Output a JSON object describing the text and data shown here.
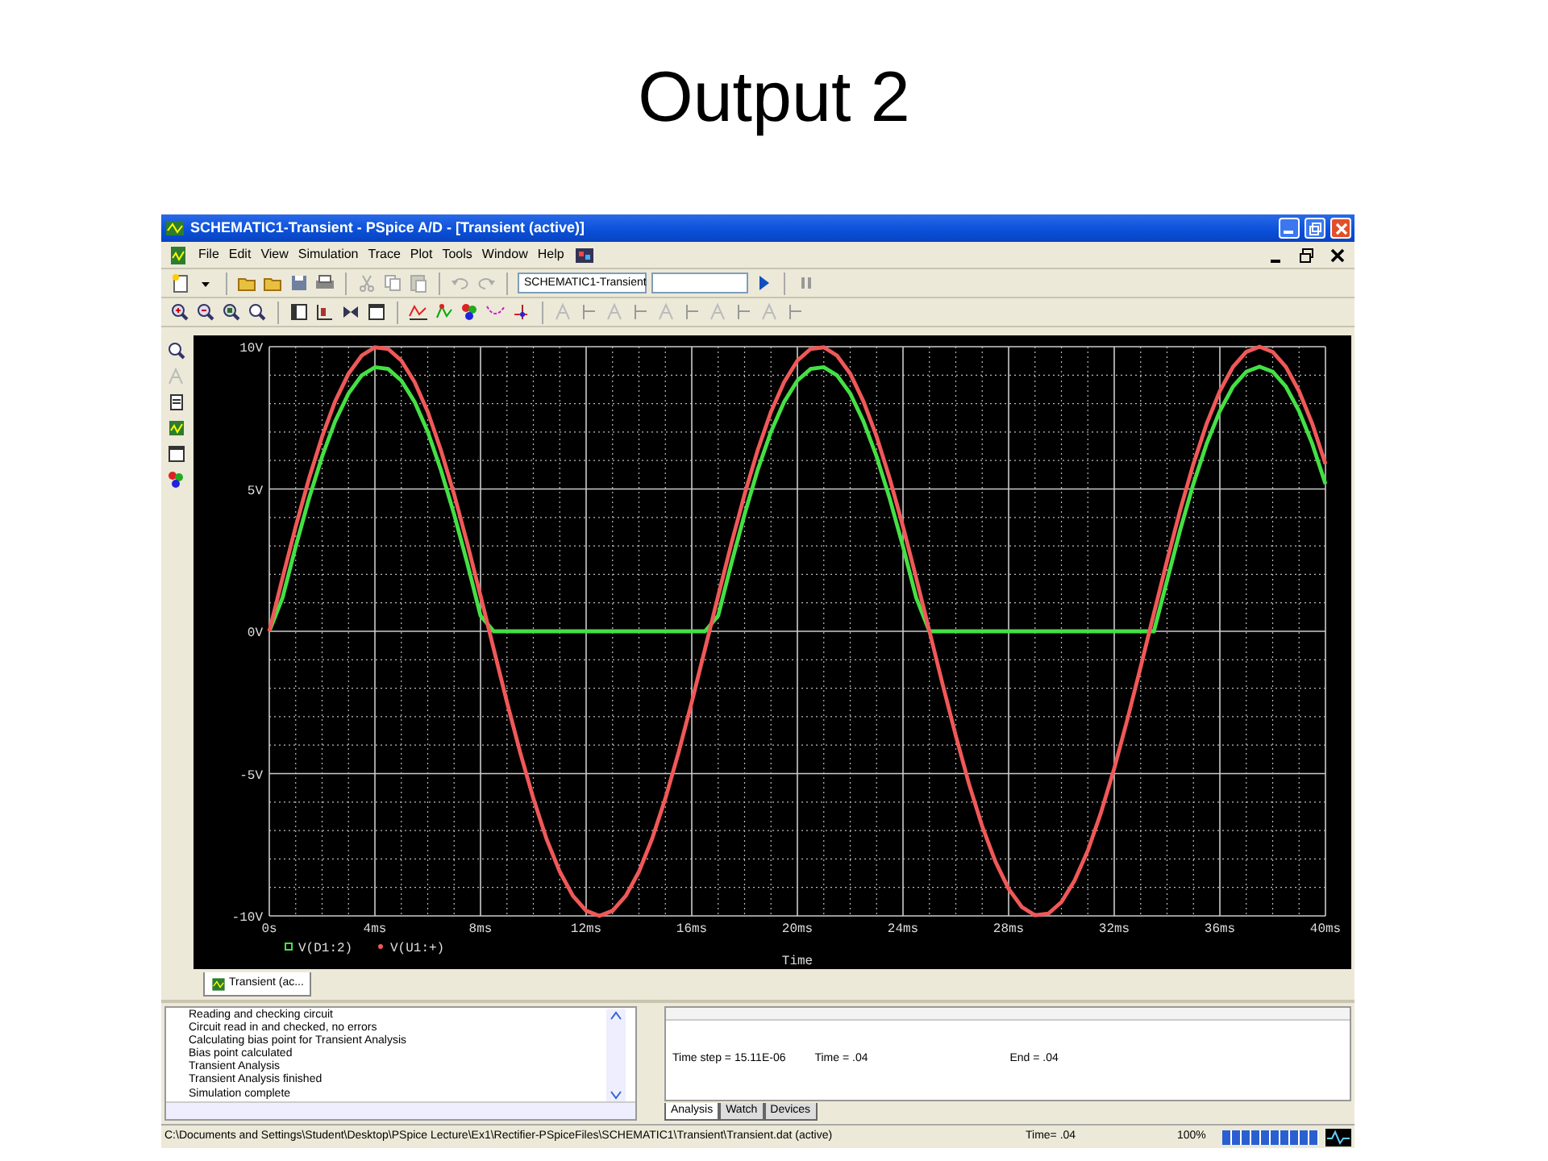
{
  "slide_title": "Output 2",
  "window": {
    "title": "SCHEMATIC1-Transient - PSpice A/D  - [Transient (active)]"
  },
  "menu": [
    "File",
    "Edit",
    "View",
    "Simulation",
    "Trace",
    "Plot",
    "Tools",
    "Window",
    "Help"
  ],
  "profile_field": {
    "value": "SCHEMATIC1-Transient"
  },
  "plot": {
    "chart_data": {
      "type": "line",
      "xlabel": "Time",
      "grid": true,
      "legend": true,
      "xlim": [
        0,
        40
      ],
      "ylim": [
        -10,
        10
      ],
      "xticks": [
        {
          "value": 0,
          "label": "0s"
        },
        {
          "value": 4,
          "label": "4ms"
        },
        {
          "value": 8,
          "label": "8ms"
        },
        {
          "value": 12,
          "label": "12ms"
        },
        {
          "value": 16,
          "label": "16ms"
        },
        {
          "value": 20,
          "label": "20ms"
        },
        {
          "value": 24,
          "label": "24ms"
        },
        {
          "value": 28,
          "label": "28ms"
        },
        {
          "value": 32,
          "label": "32ms"
        },
        {
          "value": 36,
          "label": "36ms"
        },
        {
          "value": 40,
          "label": "40ms"
        }
      ],
      "yticks": [
        {
          "value": -10,
          "label": "-10V"
        },
        {
          "value": -5,
          "label": "-5V"
        },
        {
          "value": 0,
          "label": "0V"
        },
        {
          "value": 5,
          "label": "5V"
        },
        {
          "value": 10,
          "label": "10V"
        }
      ],
      "x": [
        0,
        0.5,
        1,
        1.5,
        2,
        2.5,
        3,
        3.5,
        4,
        4.5,
        5,
        5.5,
        6,
        6.5,
        7,
        7.5,
        8,
        8.5,
        9,
        9.5,
        10,
        10.5,
        11,
        11.5,
        12,
        12.5,
        13,
        13.5,
        14,
        14.5,
        15,
        15.5,
        16,
        16.5,
        17,
        17.5,
        18,
        18.5,
        19,
        19.5,
        20,
        20.5,
        21,
        21.5,
        22,
        22.5,
        23,
        23.5,
        24,
        24.5,
        25,
        25.5,
        26,
        26.5,
        27,
        27.5,
        28,
        28.5,
        29,
        29.5,
        30,
        30.5,
        31,
        31.5,
        32,
        32.5,
        33,
        33.5,
        34,
        34.5,
        35,
        35.5,
        36,
        36.5,
        37,
        37.5,
        38,
        38.5,
        39,
        39.5,
        40
      ],
      "series": [
        {
          "name": "V(D1:2)",
          "color": "#44e044",
          "values": [
            0,
            1.17,
            2.98,
            4.66,
            6.15,
            7.39,
            8.35,
            8.99,
            9.28,
            9.22,
            8.81,
            8.06,
            7.01,
            5.67,
            4.12,
            2.39,
            0.55,
            0,
            0,
            0,
            0,
            0,
            0,
            0,
            0,
            0,
            0,
            0,
            0,
            0,
            0,
            0,
            0,
            0,
            0.55,
            2.39,
            4.12,
            5.67,
            7.01,
            8.06,
            8.81,
            9.22,
            9.28,
            8.99,
            8.35,
            7.39,
            6.15,
            4.66,
            2.98,
            1.17,
            0,
            0,
            0,
            0,
            0,
            0,
            0,
            0,
            0,
            0,
            0,
            0,
            0,
            0,
            0,
            0,
            0,
            0,
            1.79,
            3.56,
            5.18,
            6.59,
            7.74,
            8.6,
            9.12,
            9.3,
            9.12,
            8.6,
            7.74,
            6.59,
            5.18
          ]
        },
        {
          "name": "V(U1:+)",
          "color": "#f05858",
          "values": [
            0,
            1.87,
            3.68,
            5.36,
            6.85,
            8.09,
            9.05,
            9.69,
            9.98,
            9.92,
            9.51,
            8.76,
            7.71,
            6.37,
            4.82,
            3.09,
            1.25,
            -0.63,
            -2.49,
            -4.26,
            -5.88,
            -7.29,
            -8.44,
            -9.3,
            -9.82,
            -10,
            -9.82,
            -9.3,
            -8.44,
            -7.29,
            -5.88,
            -4.26,
            -2.49,
            -0.63,
            1.25,
            3.09,
            4.82,
            6.37,
            7.71,
            8.76,
            9.51,
            9.92,
            9.98,
            9.69,
            9.05,
            8.09,
            6.85,
            5.36,
            3.68,
            1.87,
            0,
            -1.87,
            -3.68,
            -5.36,
            -6.85,
            -8.09,
            -9.05,
            -9.69,
            -9.98,
            -9.92,
            -9.51,
            -8.76,
            -7.71,
            -6.37,
            -4.82,
            -3.09,
            -1.25,
            0.63,
            2.49,
            4.26,
            5.88,
            7.29,
            8.44,
            9.3,
            9.82,
            10,
            9.82,
            9.3,
            8.44,
            7.29,
            5.88
          ]
        }
      ]
    }
  },
  "plot_tabs": [
    {
      "label": "Transient (ac...",
      "selected": true
    }
  ],
  "output_log": {
    "lines": [
      "Reading and checking circuit",
      "Circuit read in and checked, no errors",
      "Calculating bias point for Transient Analysis",
      "Bias point calculated",
      "Transient Analysis",
      "Transient Analysis finished",
      "Simulation complete"
    ]
  },
  "progress_pane": {
    "time_step": "Time step =  15.11E-06",
    "time": "Time = .04",
    "end": "End = .04",
    "tabs": [
      {
        "label": "Analysis",
        "selected": true
      },
      {
        "label": "Watch",
        "selected": false
      },
      {
        "label": "Devices",
        "selected": false
      }
    ]
  },
  "status_bar": {
    "path": "C:\\Documents and Settings\\Student\\Desktop\\PSpice Lecture\\Ex1\\Rectifier-PSpiceFiles\\SCHEMATIC1\\Transient\\Transient.dat (active)",
    "time": "Time= .04",
    "percent": "100%",
    "progress": {
      "level": 1
    }
  }
}
